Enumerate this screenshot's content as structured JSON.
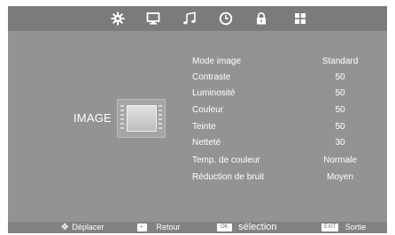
{
  "nav": {
    "icons": [
      "gear-icon",
      "monitor-icon",
      "music-icon",
      "clock-icon",
      "lock-icon",
      "grid-icon"
    ]
  },
  "section": {
    "label": "IMAGE"
  },
  "settings": [
    {
      "label": "Mode image",
      "value": "Standard"
    },
    {
      "label": "Contraste",
      "value": "50"
    },
    {
      "label": "Luminosité",
      "value": "50"
    },
    {
      "label": "Couleur",
      "value": "50"
    },
    {
      "label": "Teinte",
      "value": "50"
    },
    {
      "label": "Netteté",
      "value": "30"
    },
    {
      "label": "Temp. de couleur",
      "value": "Normale"
    },
    {
      "label": "Réduction de bruit",
      "value": "Moyen"
    }
  ],
  "footer": {
    "move": "Déplacer",
    "back_key": "⇠",
    "back": "Retour",
    "ok_key": "OK",
    "select": "sélection",
    "exit_key": "EXIT",
    "exit": "Sortie"
  },
  "colors": {
    "screen_bg": "#939393",
    "bar_bg": "#7b7b7b",
    "text": "#ffffff"
  }
}
